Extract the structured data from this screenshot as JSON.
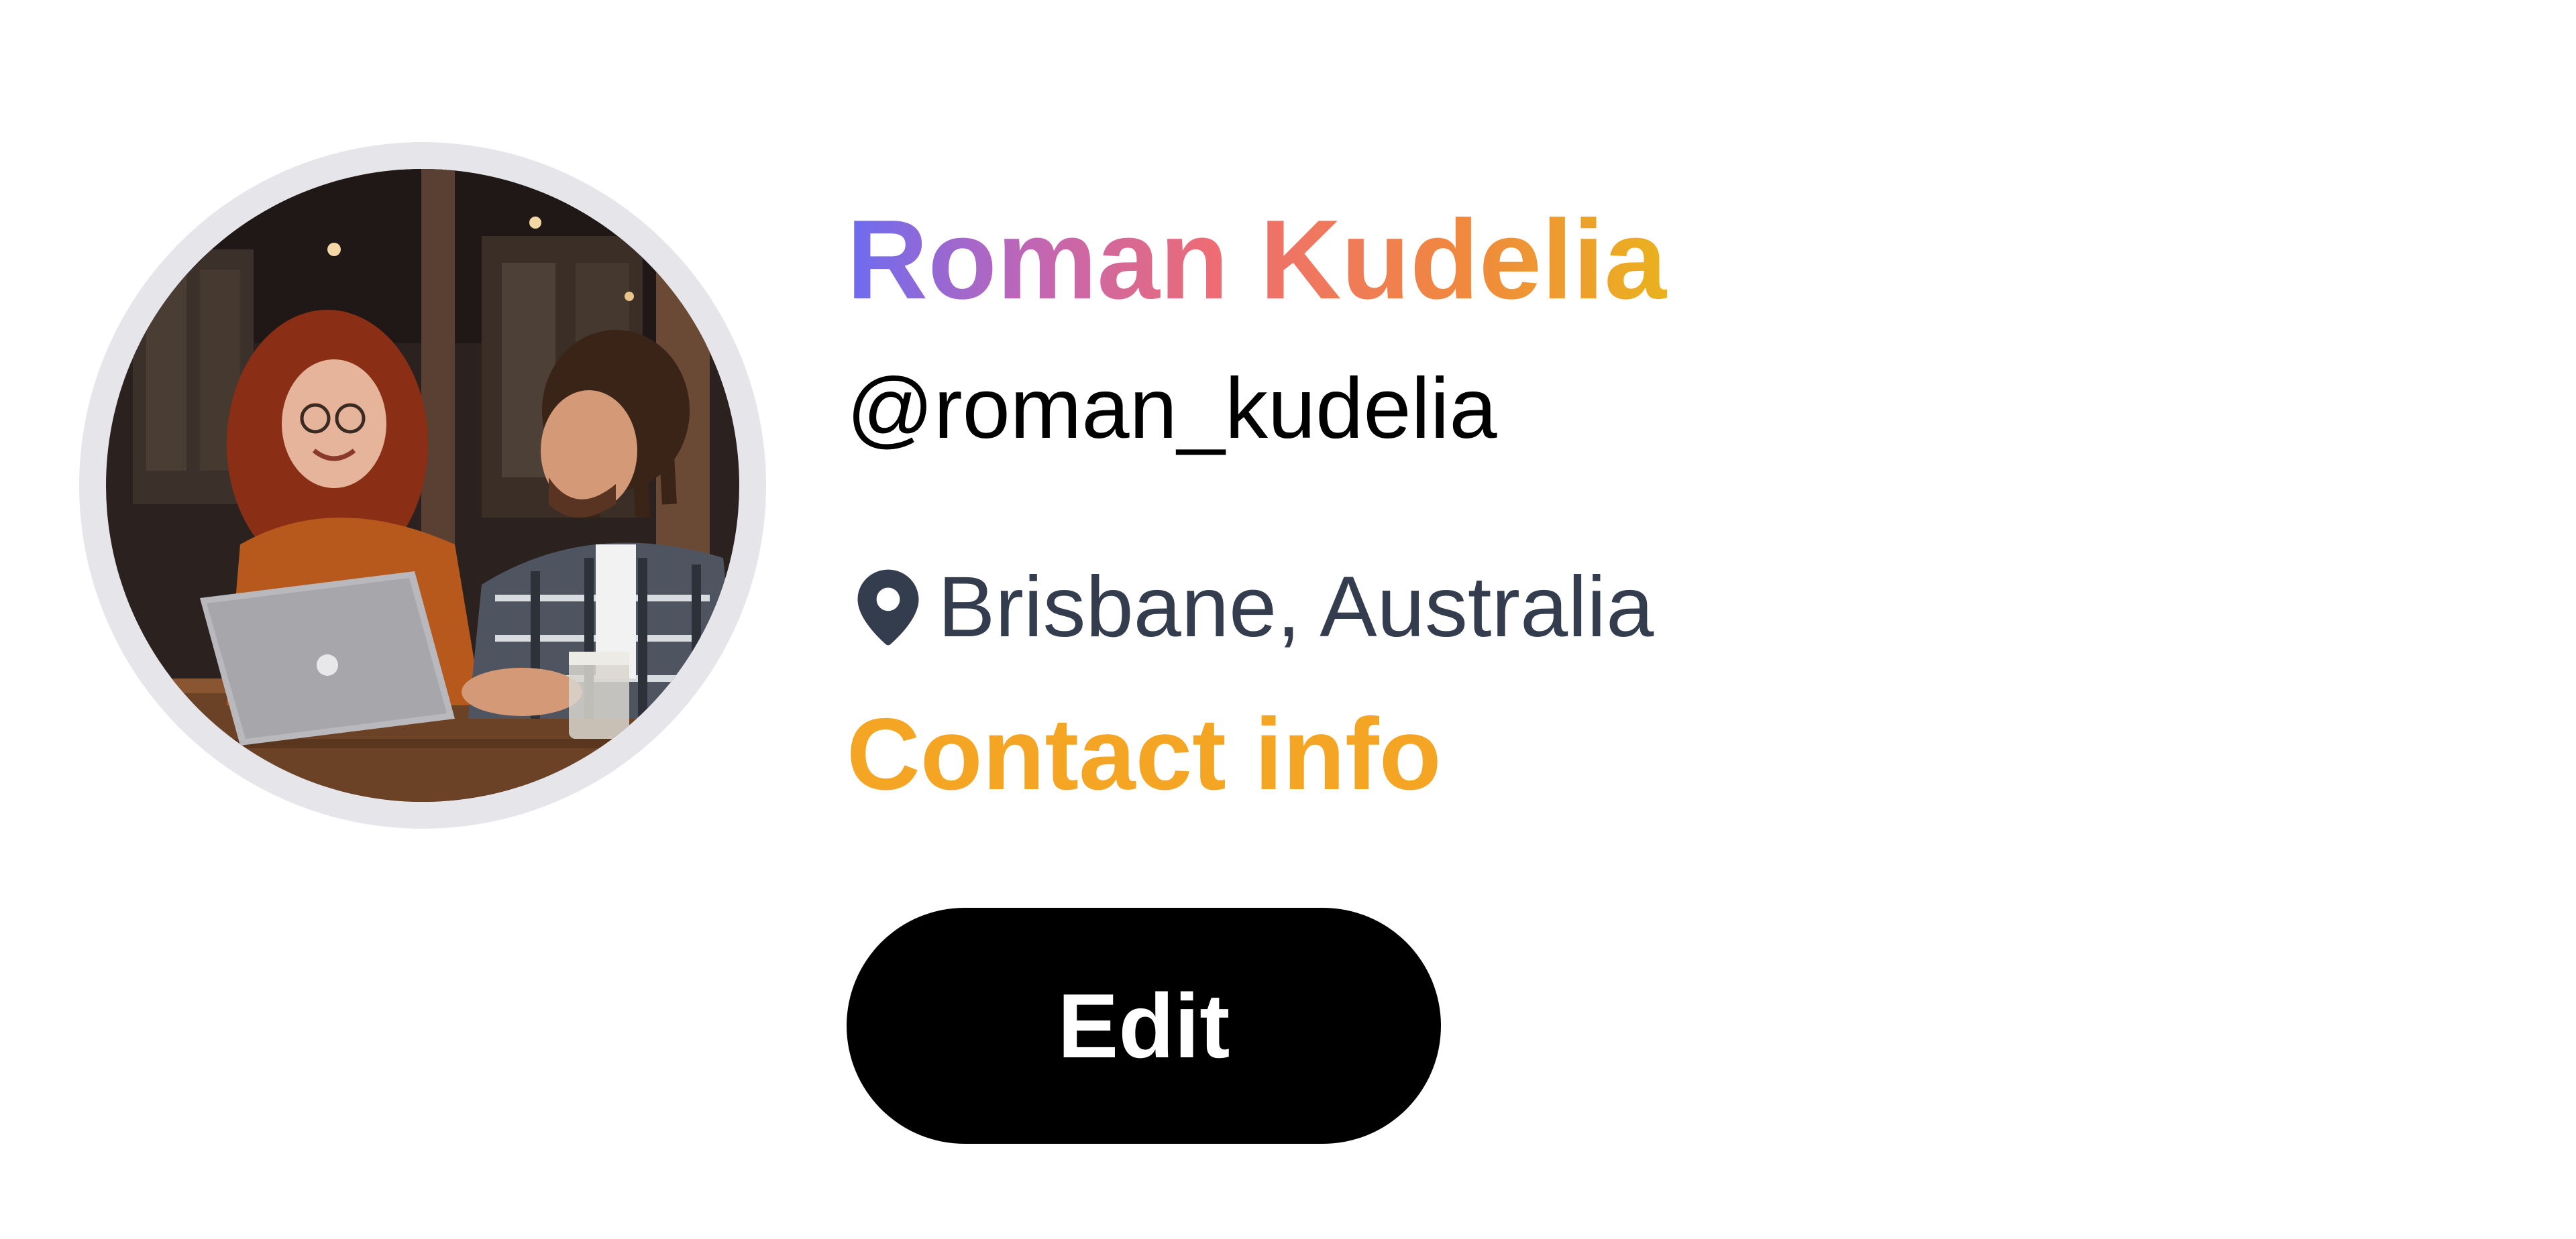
{
  "profile": {
    "name": "Roman Kudelia",
    "handle": "@roman_kudelia",
    "location": "Brisbane, Australia",
    "contact_label": "Contact info",
    "edit_label": "Edit",
    "avatar_icon": "profile-photo",
    "location_icon": "map-pin-icon"
  },
  "colors": {
    "name_gradient": [
      "#6b6cf2",
      "#c065b6",
      "#ee6c74",
      "#f0883e",
      "#eab21e"
    ],
    "contact": "#f5a524",
    "location_text": "#333d4d",
    "button_bg": "#000000",
    "button_text": "#ffffff",
    "avatar_ring": "#e5e5ea"
  }
}
